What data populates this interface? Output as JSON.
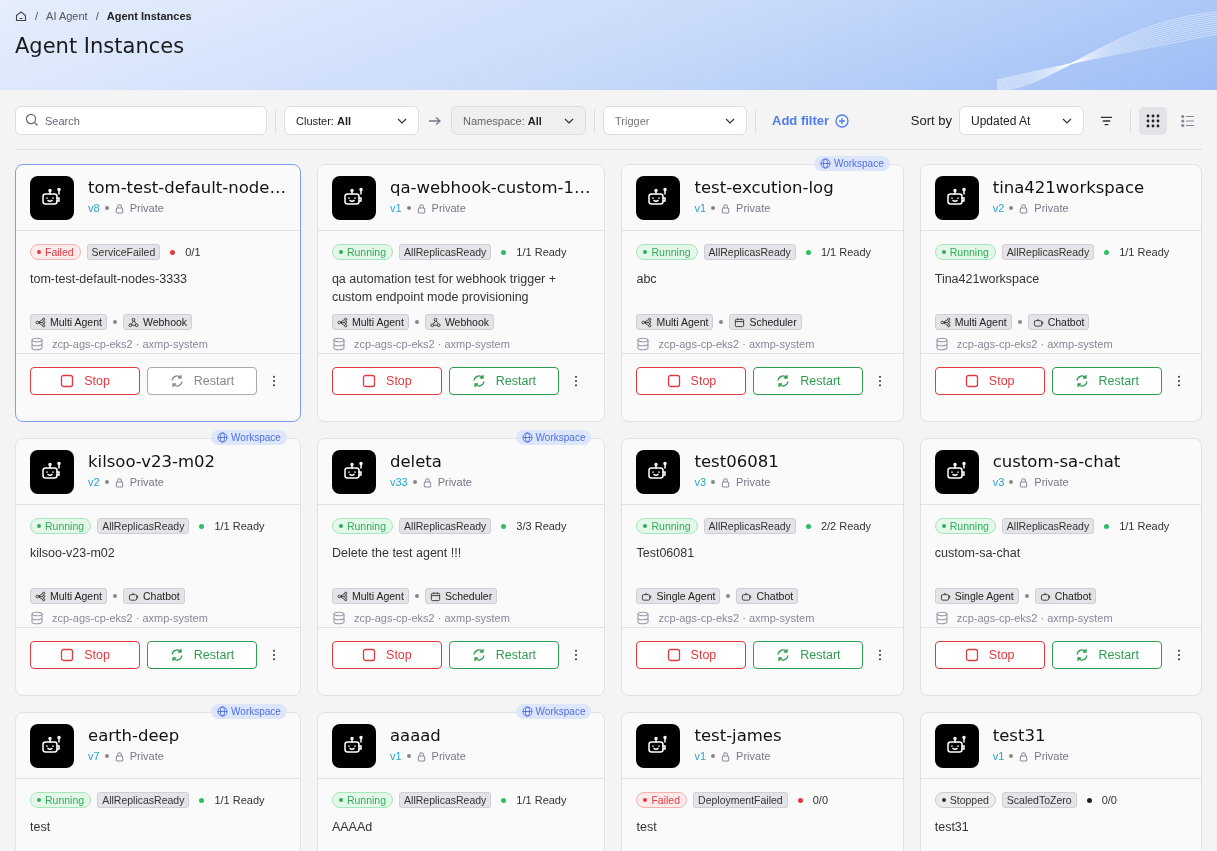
{
  "breadcrumb": [
    {
      "separator": "/",
      "label": "AI Agent",
      "current": false
    },
    {
      "separator": "/",
      "label": "Agent Instances",
      "current": true
    }
  ],
  "title": "Agent Instances",
  "toolbar": {
    "search": {
      "placeholder": "Search"
    },
    "filters": [
      {
        "kind": "select",
        "label": "Cluster:",
        "value": "All",
        "disabled": false
      },
      {
        "kind": "select",
        "label": "Namespace:",
        "value": "All",
        "disabled": true
      },
      {
        "kind": "placeholder",
        "placeholder": "Trigger",
        "disabled": false
      }
    ],
    "add_filter": "Add filter",
    "sort_label": "Sort by",
    "sort_value": "Updated At",
    "views": [
      {
        "kind": "grid",
        "selected": true
      },
      {
        "kind": "list",
        "selected": false
      }
    ]
  },
  "cards": [
    {
      "name": "tom-test-default-node…",
      "version": "v8",
      "visibility": "Private",
      "workspace": false,
      "selected": true,
      "status": {
        "kind": "failed",
        "label": "Failed"
      },
      "condition": "ServiceFailed",
      "ready": "0/1",
      "description": "tom-test-default-nodes-3333",
      "agent_type": {
        "kind": "multi",
        "label": "Multi Agent"
      },
      "trigger": {
        "kind": "webhook",
        "label": "Webhook"
      },
      "location": "zcp-ags-cp-eks2 · axmp-system",
      "actions": {
        "stop": "Stop",
        "restart": "Restart",
        "restart_enabled": false
      }
    },
    {
      "name": "qa-webhook-custom-1…",
      "version": "v1",
      "visibility": "Private",
      "workspace": false,
      "selected": false,
      "status": {
        "kind": "running",
        "label": "Running"
      },
      "condition": "AllReplicasReady",
      "ready": "1/1 Ready",
      "description": "qa automation test for webhook trigger + custom endpoint mode provisioning",
      "agent_type": {
        "kind": "multi",
        "label": "Multi Agent"
      },
      "trigger": {
        "kind": "webhook",
        "label": "Webhook"
      },
      "location": "zcp-ags-cp-eks2 · axmp-system",
      "actions": {
        "stop": "Stop",
        "restart": "Restart",
        "restart_enabled": true
      }
    },
    {
      "name": "test-excution-log",
      "version": "v1",
      "visibility": "Private",
      "workspace": true,
      "workspace_label": "Workspace",
      "selected": false,
      "status": {
        "kind": "running",
        "label": "Running"
      },
      "condition": "AllReplicasReady",
      "ready": "1/1 Ready",
      "description": "abc",
      "agent_type": {
        "kind": "multi",
        "label": "Multi Agent"
      },
      "trigger": {
        "kind": "scheduler",
        "label": "Scheduler"
      },
      "location": "zcp-ags-cp-eks2 · axmp-system",
      "actions": {
        "stop": "Stop",
        "restart": "Restart",
        "restart_enabled": true
      }
    },
    {
      "name": "tina421workspace",
      "version": "v2",
      "visibility": "Private",
      "workspace": false,
      "selected": false,
      "status": {
        "kind": "running",
        "label": "Running"
      },
      "condition": "AllReplicasReady",
      "ready": "1/1 Ready",
      "description": "Tina421workspace",
      "agent_type": {
        "kind": "multi",
        "label": "Multi Agent"
      },
      "trigger": {
        "kind": "chatbot",
        "label": "Chatbot"
      },
      "location": "zcp-ags-cp-eks2 · axmp-system",
      "actions": {
        "stop": "Stop",
        "restart": "Restart",
        "restart_enabled": true
      }
    },
    {
      "name": "kilsoo-v23-m02",
      "version": "v2",
      "visibility": "Private",
      "workspace": true,
      "workspace_label": "Workspace",
      "selected": false,
      "status": {
        "kind": "running",
        "label": "Running"
      },
      "condition": "AllReplicasReady",
      "ready": "1/1 Ready",
      "description": "kilsoo-v23-m02",
      "agent_type": {
        "kind": "multi",
        "label": "Multi Agent"
      },
      "trigger": {
        "kind": "chatbot",
        "label": "Chatbot"
      },
      "location": "zcp-ags-cp-eks2 · axmp-system",
      "actions": {
        "stop": "Stop",
        "restart": "Restart",
        "restart_enabled": true
      }
    },
    {
      "name": "deleta",
      "version": "v33",
      "visibility": "Private",
      "workspace": true,
      "workspace_label": "Workspace",
      "selected": false,
      "status": {
        "kind": "running",
        "label": "Running"
      },
      "condition": "AllReplicasReady",
      "ready": "3/3 Ready",
      "description": "Delete the test agent !!!",
      "agent_type": {
        "kind": "multi",
        "label": "Multi Agent"
      },
      "trigger": {
        "kind": "scheduler",
        "label": "Scheduler"
      },
      "location": "zcp-ags-cp-eks2 · axmp-system",
      "actions": {
        "stop": "Stop",
        "restart": "Restart",
        "restart_enabled": true
      }
    },
    {
      "name": "test06081",
      "version": "v3",
      "visibility": "Private",
      "workspace": false,
      "selected": false,
      "status": {
        "kind": "running",
        "label": "Running"
      },
      "condition": "AllReplicasReady",
      "ready": "2/2 Ready",
      "description": "Test06081",
      "agent_type": {
        "kind": "single",
        "label": "Single Agent"
      },
      "trigger": {
        "kind": "chatbot",
        "label": "Chatbot"
      },
      "location": "zcp-ags-cp-eks2 · axmp-system",
      "actions": {
        "stop": "Stop",
        "restart": "Restart",
        "restart_enabled": true
      }
    },
    {
      "name": "custom-sa-chat",
      "version": "v3",
      "visibility": "Private",
      "workspace": false,
      "selected": false,
      "status": {
        "kind": "running",
        "label": "Running"
      },
      "condition": "AllReplicasReady",
      "ready": "1/1 Ready",
      "description": "custom-sa-chat",
      "agent_type": {
        "kind": "single",
        "label": "Single Agent"
      },
      "trigger": {
        "kind": "chatbot",
        "label": "Chatbot"
      },
      "location": "zcp-ags-cp-eks2 · axmp-system",
      "actions": {
        "stop": "Stop",
        "restart": "Restart",
        "restart_enabled": true
      }
    },
    {
      "name": "earth-deep",
      "version": "v7",
      "visibility": "Private",
      "workspace": true,
      "workspace_label": "Workspace",
      "selected": false,
      "status": {
        "kind": "running",
        "label": "Running"
      },
      "condition": "AllReplicasReady",
      "ready": "1/1 Ready",
      "description": "test"
    },
    {
      "name": "aaaad",
      "version": "v1",
      "visibility": "Private",
      "workspace": true,
      "workspace_label": "Workspace",
      "selected": false,
      "status": {
        "kind": "running",
        "label": "Running"
      },
      "condition": "AllReplicasReady",
      "ready": "1/1 Ready",
      "description": "AAAAd"
    },
    {
      "name": "test-james",
      "version": "v1",
      "visibility": "Private",
      "workspace": false,
      "selected": false,
      "status": {
        "kind": "failed",
        "label": "Failed"
      },
      "condition": "DeploymentFailed",
      "ready": "0/0",
      "description": "test"
    },
    {
      "name": "test31",
      "version": "v1",
      "visibility": "Private",
      "workspace": false,
      "selected": false,
      "status": {
        "kind": "stopped",
        "label": "Stopped"
      },
      "condition": "ScaledToZero",
      "ready": "0/0",
      "description": "test31"
    }
  ]
}
